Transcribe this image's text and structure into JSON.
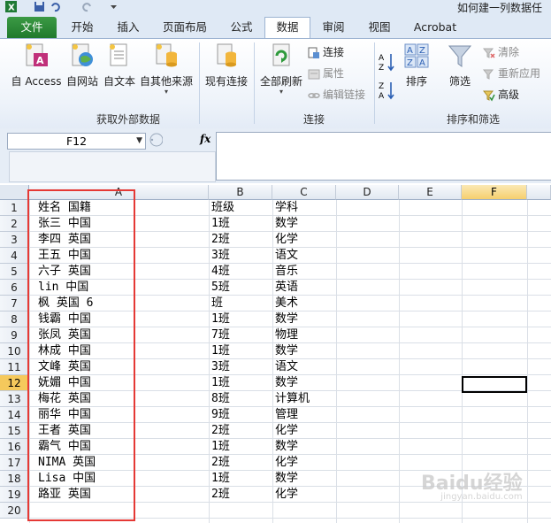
{
  "window": {
    "title": "如何建一列数据任"
  },
  "ribbon_tabs": [
    {
      "label": "文件"
    },
    {
      "label": "开始"
    },
    {
      "label": "插入"
    },
    {
      "label": "页面布局"
    },
    {
      "label": "公式"
    },
    {
      "label": "数据"
    },
    {
      "label": "审阅"
    },
    {
      "label": "视图"
    },
    {
      "label": "Acrobat"
    }
  ],
  "active_tab": "数据",
  "ribbon": {
    "get_external": {
      "label": "获取外部数据",
      "buttons": [
        "自 Access",
        "自网站",
        "自文本",
        "自其他来源",
        "现有连接"
      ]
    },
    "connections": {
      "label": "连接",
      "refresh_all": "全部刷新",
      "connect": "连接",
      "properties": "属性",
      "edit_links": "编辑链接"
    },
    "sort_filter": {
      "label": "排序和筛选",
      "sort": "排序",
      "filter": "筛选",
      "clear": "清除",
      "reapply": "重新应用",
      "advanced": "高级"
    }
  },
  "formula_bar": {
    "name_box": "F12",
    "fx_label": "fx",
    "value": ""
  },
  "sheet": {
    "columns": [
      "A",
      "B",
      "C",
      "D",
      "E",
      "F"
    ],
    "selected_column": "F",
    "selected_row": "12",
    "rows": [
      {
        "n": "1",
        "a": "姓名 国籍",
        "b": "班级",
        "c": "学科"
      },
      {
        "n": "2",
        "a": "张三 中国",
        "b": "1班",
        "c": "数学"
      },
      {
        "n": "3",
        "a": "李四 英国",
        "b": "2班",
        "c": "化学"
      },
      {
        "n": "4",
        "a": "王五 中国",
        "b": "3班",
        "c": "语文"
      },
      {
        "n": "5",
        "a": "六子 英国",
        "b": "4班",
        "c": "音乐"
      },
      {
        "n": "6",
        "a": "lin 中国",
        "b": "5班",
        "c": "英语"
      },
      {
        "n": "7",
        "a": "枫 英国 6",
        "b": "班",
        "c": "美术"
      },
      {
        "n": "8",
        "a": "钱霸 中国",
        "b": "1班",
        "c": "数学"
      },
      {
        "n": "9",
        "a": "张凤 英国",
        "b": "7班",
        "c": "物理"
      },
      {
        "n": "10",
        "a": "林成 中国",
        "b": "1班",
        "c": "数学"
      },
      {
        "n": "11",
        "a": "文峰 英国",
        "b": "3班",
        "c": "语文"
      },
      {
        "n": "12",
        "a": "妩媚 中国",
        "b": "1班",
        "c": "数学"
      },
      {
        "n": "13",
        "a": "梅花 英国",
        "b": "8班",
        "c": "计算机"
      },
      {
        "n": "14",
        "a": "丽华 中国",
        "b": "9班",
        "c": "管理"
      },
      {
        "n": "15",
        "a": "王者 英国",
        "b": "2班",
        "c": "化学"
      },
      {
        "n": "16",
        "a": "霸气 中国",
        "b": "1班",
        "c": "数学"
      },
      {
        "n": "17",
        "a": "NIMA 英国",
        "b": "2班",
        "c": "化学"
      },
      {
        "n": "18",
        "a": "Lisa 中国",
        "b": "1班",
        "c": "数学"
      },
      {
        "n": "19",
        "a": "路亚 英国",
        "b": "2班",
        "c": "化学"
      },
      {
        "n": "20",
        "a": "",
        "b": "",
        "c": ""
      }
    ]
  },
  "watermark": {
    "text": "Baidu经验",
    "sub": "jingyan.baidu.com"
  },
  "colors": {
    "file_tab": "#2e8b3a",
    "highlight_box": "#e53935",
    "selected_header": "#f5c95c"
  }
}
